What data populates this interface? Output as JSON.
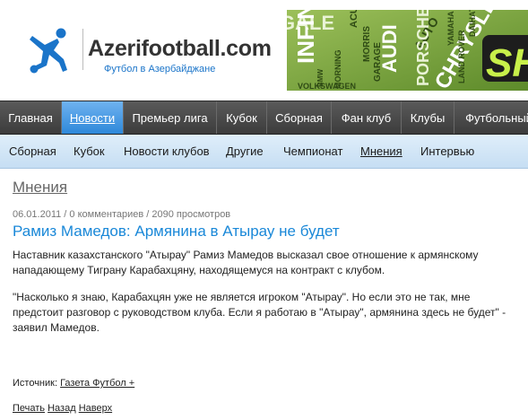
{
  "header": {
    "site_title": "Azerifootball.com",
    "site_subtitle": "Футбол в Азербайджане",
    "banner_words": [
      "GALE",
      "INFINITI",
      "ACURA",
      "MORRIS",
      "GARAGE",
      "AUDI",
      "AUTO",
      "PORSCHE",
      "CHRYSLER",
      "YAMAHA",
      "LAND ROVER",
      "MORNING",
      "DAIHATSU",
      "BMW",
      "VOLKSWAGEN",
      "SH"
    ]
  },
  "main_nav": [
    {
      "label": "Главная",
      "active": false
    },
    {
      "label": "Новости",
      "active": true
    },
    {
      "label": "Премьер лига",
      "active": false
    },
    {
      "label": "Кубок",
      "active": false
    },
    {
      "label": "Сборная",
      "active": false
    },
    {
      "label": "Фан клуб",
      "active": false
    },
    {
      "label": "Клубы",
      "active": false
    },
    {
      "label": "Футбольный",
      "active": false
    }
  ],
  "sub_nav": [
    {
      "label": "Сборная",
      "active": false
    },
    {
      "label": "Кубок",
      "active": false
    },
    {
      "label": "Новости клубов",
      "active": false
    },
    {
      "label": "Другие",
      "active": false
    },
    {
      "label": "Чемпионат",
      "active": false
    },
    {
      "label": "Мнения",
      "active": true
    },
    {
      "label": "Интервью",
      "active": false
    }
  ],
  "content": {
    "section_title": "Мнения",
    "meta": "06.01.2011 / 0 комментариев / 2090 просмотров",
    "article_title": "Рамиз Мамедов: Армянина в Атырау не будет",
    "paragraph_1": "Наставник казахстанского \"Атырау\" Рамиз Мамедов высказал свое отношение к армянскому нападающему Тиграну Карабахцяну, находящемуся на контракт с клубом.",
    "paragraph_2": "\"Насколько я знаю, Карабахцян уже не является игроком \"Атырау\". Но если это не так, мне предстоит разговор с руководством клуба. Если я работаю в \"Атырау\", армянина здесь не будет\" - заявил Мамедов.",
    "source_label": "Источник:",
    "source_link": "Газета Футбол +",
    "print_link": "Печать",
    "back_link": "Назад",
    "top_link": "Наверх"
  },
  "colors": {
    "accent_blue": "#1a88d8",
    "nav_dark": "#4a4a4a",
    "subnav_light": "#d4e8f8",
    "banner_green": "#7fa742"
  }
}
